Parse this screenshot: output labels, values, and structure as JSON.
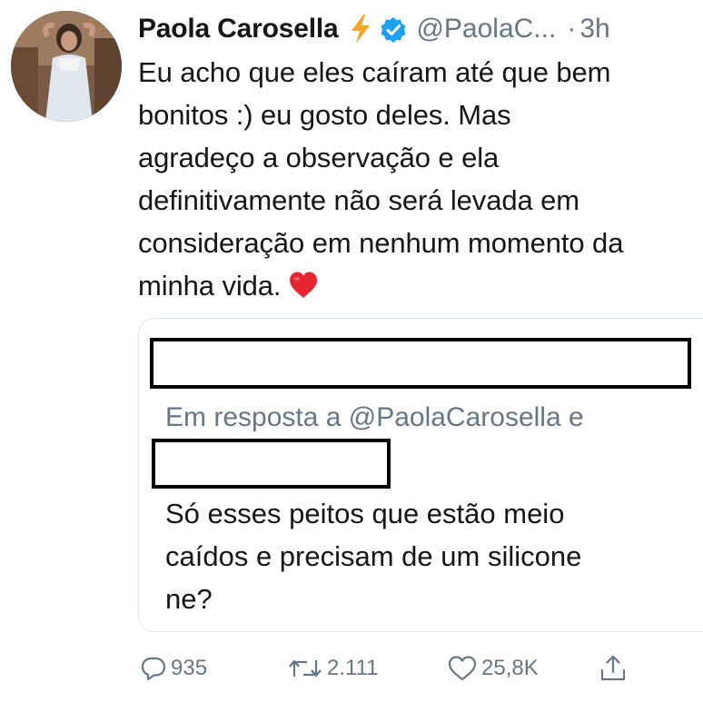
{
  "tweet": {
    "author_name": "Paola Carosella",
    "handle": "@PaolaC...",
    "separator": "·",
    "time": "3h",
    "text": "Eu acho que eles caíram até que bem\nbonitos :) eu gosto deles.  Mas\nagradeço a observação e ela\ndefinitivamente não será levada em\nconsideração em nenhum momento da\nminha vida.",
    "emoji": "red-heart"
  },
  "quoted_tweet": {
    "reply_to_label": "Em resposta a @PaolaCarosella e",
    "text": "Só esses peitos que estão meio\ncaídos e precisam de um silicone\nne?"
  },
  "actions": {
    "replies": "935",
    "retweets": "2.111",
    "likes": "25,8K"
  },
  "icons": {
    "badge": "lightning-bolt-icon",
    "verified": "verified-badge-icon",
    "reply": "reply-icon",
    "retweet": "retweet-icon",
    "like": "heart-icon",
    "share": "share-icon"
  },
  "colors": {
    "text": "#14171a",
    "secondary": "#657786",
    "verified": "#1da1f2",
    "bolt": "#f5a623",
    "heart_emoji": "#e3262f",
    "border": "#e1e8ed"
  }
}
